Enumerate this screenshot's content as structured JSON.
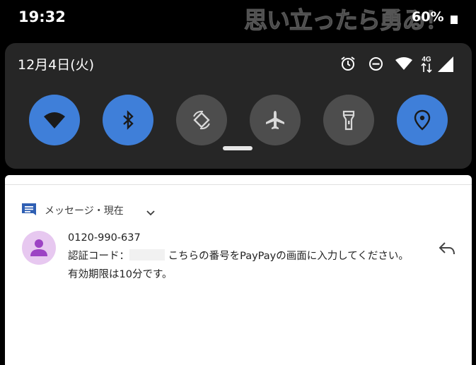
{
  "status_bar": {
    "time": "19:32",
    "battery": "60%",
    "watermark": "思い立ったら勇ゐ！"
  },
  "quick_settings": {
    "date": "12月4日(火)",
    "status_icons": [
      "alarm-icon",
      "do-not-disturb-icon",
      "wifi-signal-icon",
      "4g-icon",
      "cell-signal-icon"
    ],
    "network_label": "4G",
    "tiles": [
      {
        "name": "wifi",
        "state": "on"
      },
      {
        "name": "bluetooth",
        "state": "on"
      },
      {
        "name": "auto-rotate",
        "state": "off"
      },
      {
        "name": "airplane-mode",
        "state": "off"
      },
      {
        "name": "flashlight",
        "state": "off"
      },
      {
        "name": "location",
        "state": "on"
      }
    ],
    "colors": {
      "tile_on": "#3f7fd9",
      "tile_off": "#4d4d4d",
      "panel": "#262626"
    }
  },
  "notification": {
    "app_label": "メッセージ・現在",
    "sender": "0120-990-637",
    "message_prefix": "認証コード：",
    "message_suffix": "こちらの番号をPayPayの画面に入力してください。有効期限は10分です。",
    "accent": "#2f5fb3"
  }
}
